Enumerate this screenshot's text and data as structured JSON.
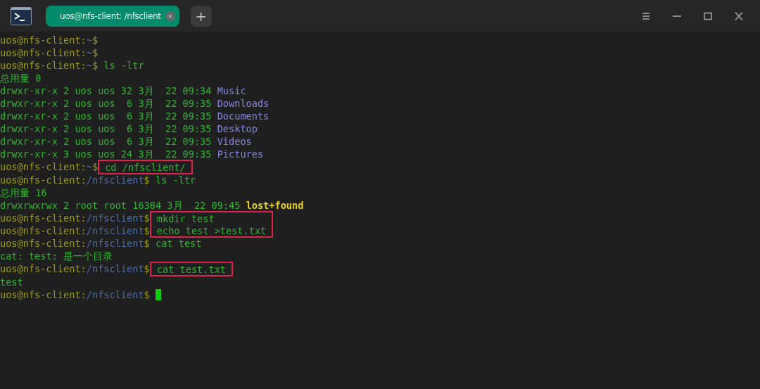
{
  "tabs": [
    {
      "label": "uos@nfs-client: /nfsclient",
      "close": "×",
      "selected": true
    }
  ],
  "new_tab": "+",
  "lines": [
    {
      "kind": "prompt",
      "host": "uos@nfs-client:",
      "path": "~",
      "sign": "$"
    },
    {
      "kind": "prompt",
      "host": "uos@nfs-client:",
      "path": "~",
      "sign": "$"
    },
    {
      "kind": "prompt",
      "host": "uos@nfs-client:",
      "path": "~",
      "sign": "$",
      "command": " ls -ltr"
    },
    {
      "kind": "output",
      "text": "总用量 0"
    },
    {
      "kind": "entry",
      "info": "drwxr-xr-x 2 uos uos 32 3月  22 09:34 ",
      "name": "Music"
    },
    {
      "kind": "entry",
      "info": "drwxr-xr-x 2 uos uos  6 3月  22 09:35 ",
      "name": "Downloads"
    },
    {
      "kind": "entry",
      "info": "drwxr-xr-x 2 uos uos  6 3月  22 09:35 ",
      "name": "Documents"
    },
    {
      "kind": "entry",
      "info": "drwxr-xr-x 2 uos uos  6 3月  22 09:35 ",
      "name": "Desktop"
    },
    {
      "kind": "entry",
      "info": "drwxr-xr-x 2 uos uos  6 3月  22 09:35 ",
      "name": "Videos"
    },
    {
      "kind": "entry",
      "info": "drwxr-xr-x 3 uos uos 24 3月  22 09:35 ",
      "name": "Pictures"
    },
    {
      "kind": "highlight",
      "rows": [
        {
          "host": "uos@nfs-client:",
          "path": "~",
          "sign": "$",
          "command": "cd /nfsclient/"
        }
      ]
    },
    {
      "kind": "prompt",
      "host": "uos@nfs-client:",
      "path": "/nfsclient",
      "sign": "$",
      "command": " ls -ltr"
    },
    {
      "kind": "output",
      "text": "总用量 16"
    },
    {
      "kind": "special_entry",
      "info": "drwxrwxrwx 2 root root 16384 3月  22 09:45 ",
      "name": "lost+found"
    },
    {
      "kind": "highlight",
      "rows": [
        {
          "host": "uos@nfs-client:",
          "path": "/nfsclient",
          "sign": "$",
          "command": "mkdir test"
        },
        {
          "host": "uos@nfs-client:",
          "path": "/nfsclient",
          "sign": "$",
          "command": "echo test >test.txt"
        }
      ]
    },
    {
      "kind": "prompt",
      "host": "uos@nfs-client:",
      "path": "/nfsclient",
      "sign": "$",
      "command": " cat test"
    },
    {
      "kind": "output",
      "text": "cat: test: 是一个目录"
    },
    {
      "kind": "highlight",
      "rows": [
        {
          "host": "uos@nfs-client:",
          "path": "/nfsclient",
          "sign": "$",
          "command": "cat test.txt"
        }
      ]
    },
    {
      "kind": "output",
      "text": "test"
    },
    {
      "kind": "prompt",
      "host": "uos@nfs-client:",
      "path": "/nfsclient",
      "sign": "$",
      "cursor": true
    }
  ]
}
